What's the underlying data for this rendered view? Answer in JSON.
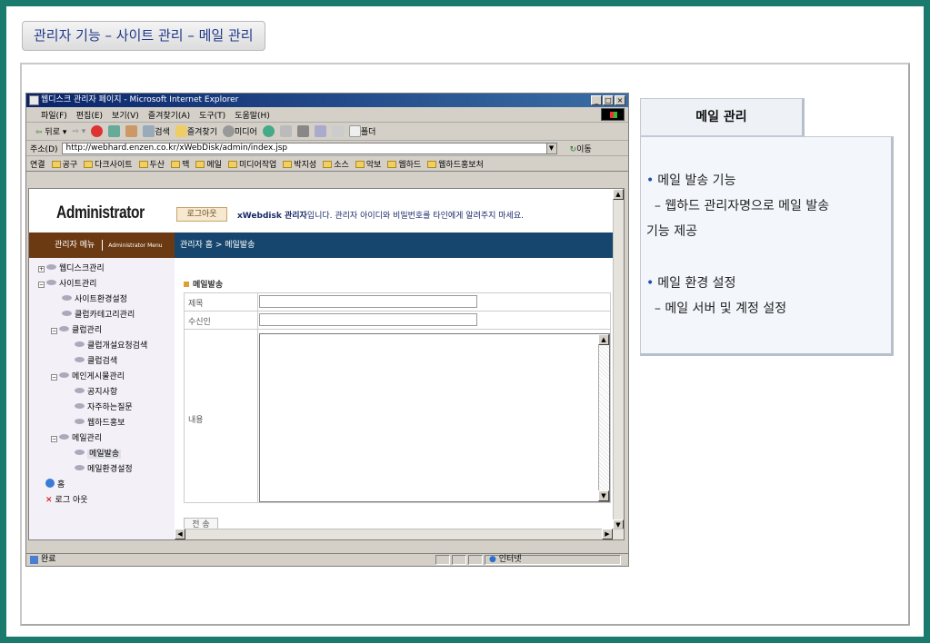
{
  "slide": {
    "title": "관리자 기능 – 사이트 관리 – 메일 관리"
  },
  "browser": {
    "window_title": "웹디스크 관리자 페이지 - Microsoft Internet Explorer",
    "window_buttons": [
      "_",
      "□",
      "×"
    ],
    "menu": [
      "파일(F)",
      "편집(E)",
      "보기(V)",
      "즐겨찾기(A)",
      "도구(T)",
      "도움말(H)"
    ],
    "toolbar": {
      "back": "뒤로",
      "search": "검색",
      "favorites": "즐겨찾기",
      "media": "미디어",
      "folder": "폴더"
    },
    "address_label": "주소(D)",
    "address_url": "http://webhard.enzen.co.kr/xWebDisk/admin/index.jsp",
    "go_label": "이동",
    "links_label": "연결",
    "links": [
      "공구",
      "다크사이트",
      "두산",
      "맥",
      "메일",
      "미디어작업",
      "박지성",
      "소스",
      "악보",
      "웹하드",
      "웹하드홍보처"
    ],
    "status_text": "완료",
    "zone_text": "인터넷"
  },
  "page": {
    "logo": "Administrator",
    "logout_label": "로그아웃",
    "notice_bold": "xWebdisk 관리자",
    "notice_text": "입니다. 관리자 아이디와 비밀번호를 타인에게 알려주지 마세요.",
    "menu_title": "관리자 메뉴",
    "menu_subtitle": "Administrator Menu",
    "breadcrumb": "관리자 홈 > 메일발송",
    "tree": {
      "web_disk": "웹디스크관리",
      "site": "사이트관리",
      "site_env": "사이트환경설정",
      "club_category": "클럽카테고리관리",
      "club": "클럽관리",
      "club_request": "클럽개설요청검색",
      "club_search": "클럽검색",
      "main_board": "메인게시물관리",
      "notice": "공지사항",
      "faq": "자주하는질문",
      "promo": "웹하드홍보",
      "mail": "메일관리",
      "mail_send": "메일발송",
      "mail_env": "메일환경설정",
      "home": "홈",
      "logout": "로그 아웃"
    },
    "form": {
      "section_title": "메일발송",
      "subject_label": "제목",
      "recipient_label": "수신인",
      "content_label": "내용",
      "send_label": "전  송"
    }
  },
  "panel": {
    "title": "메일 관리",
    "items": [
      {
        "bullet": "•",
        "heading": "메일 발송 기능",
        "detail_1": "  – 웹하드 관리자명으로 메일 발송",
        "detail_2": "기능 제공"
      },
      {
        "bullet": "•",
        "heading": "메일 환경 설정",
        "detail_1": "  – 메일 서버 및 계정 설정"
      }
    ]
  }
}
